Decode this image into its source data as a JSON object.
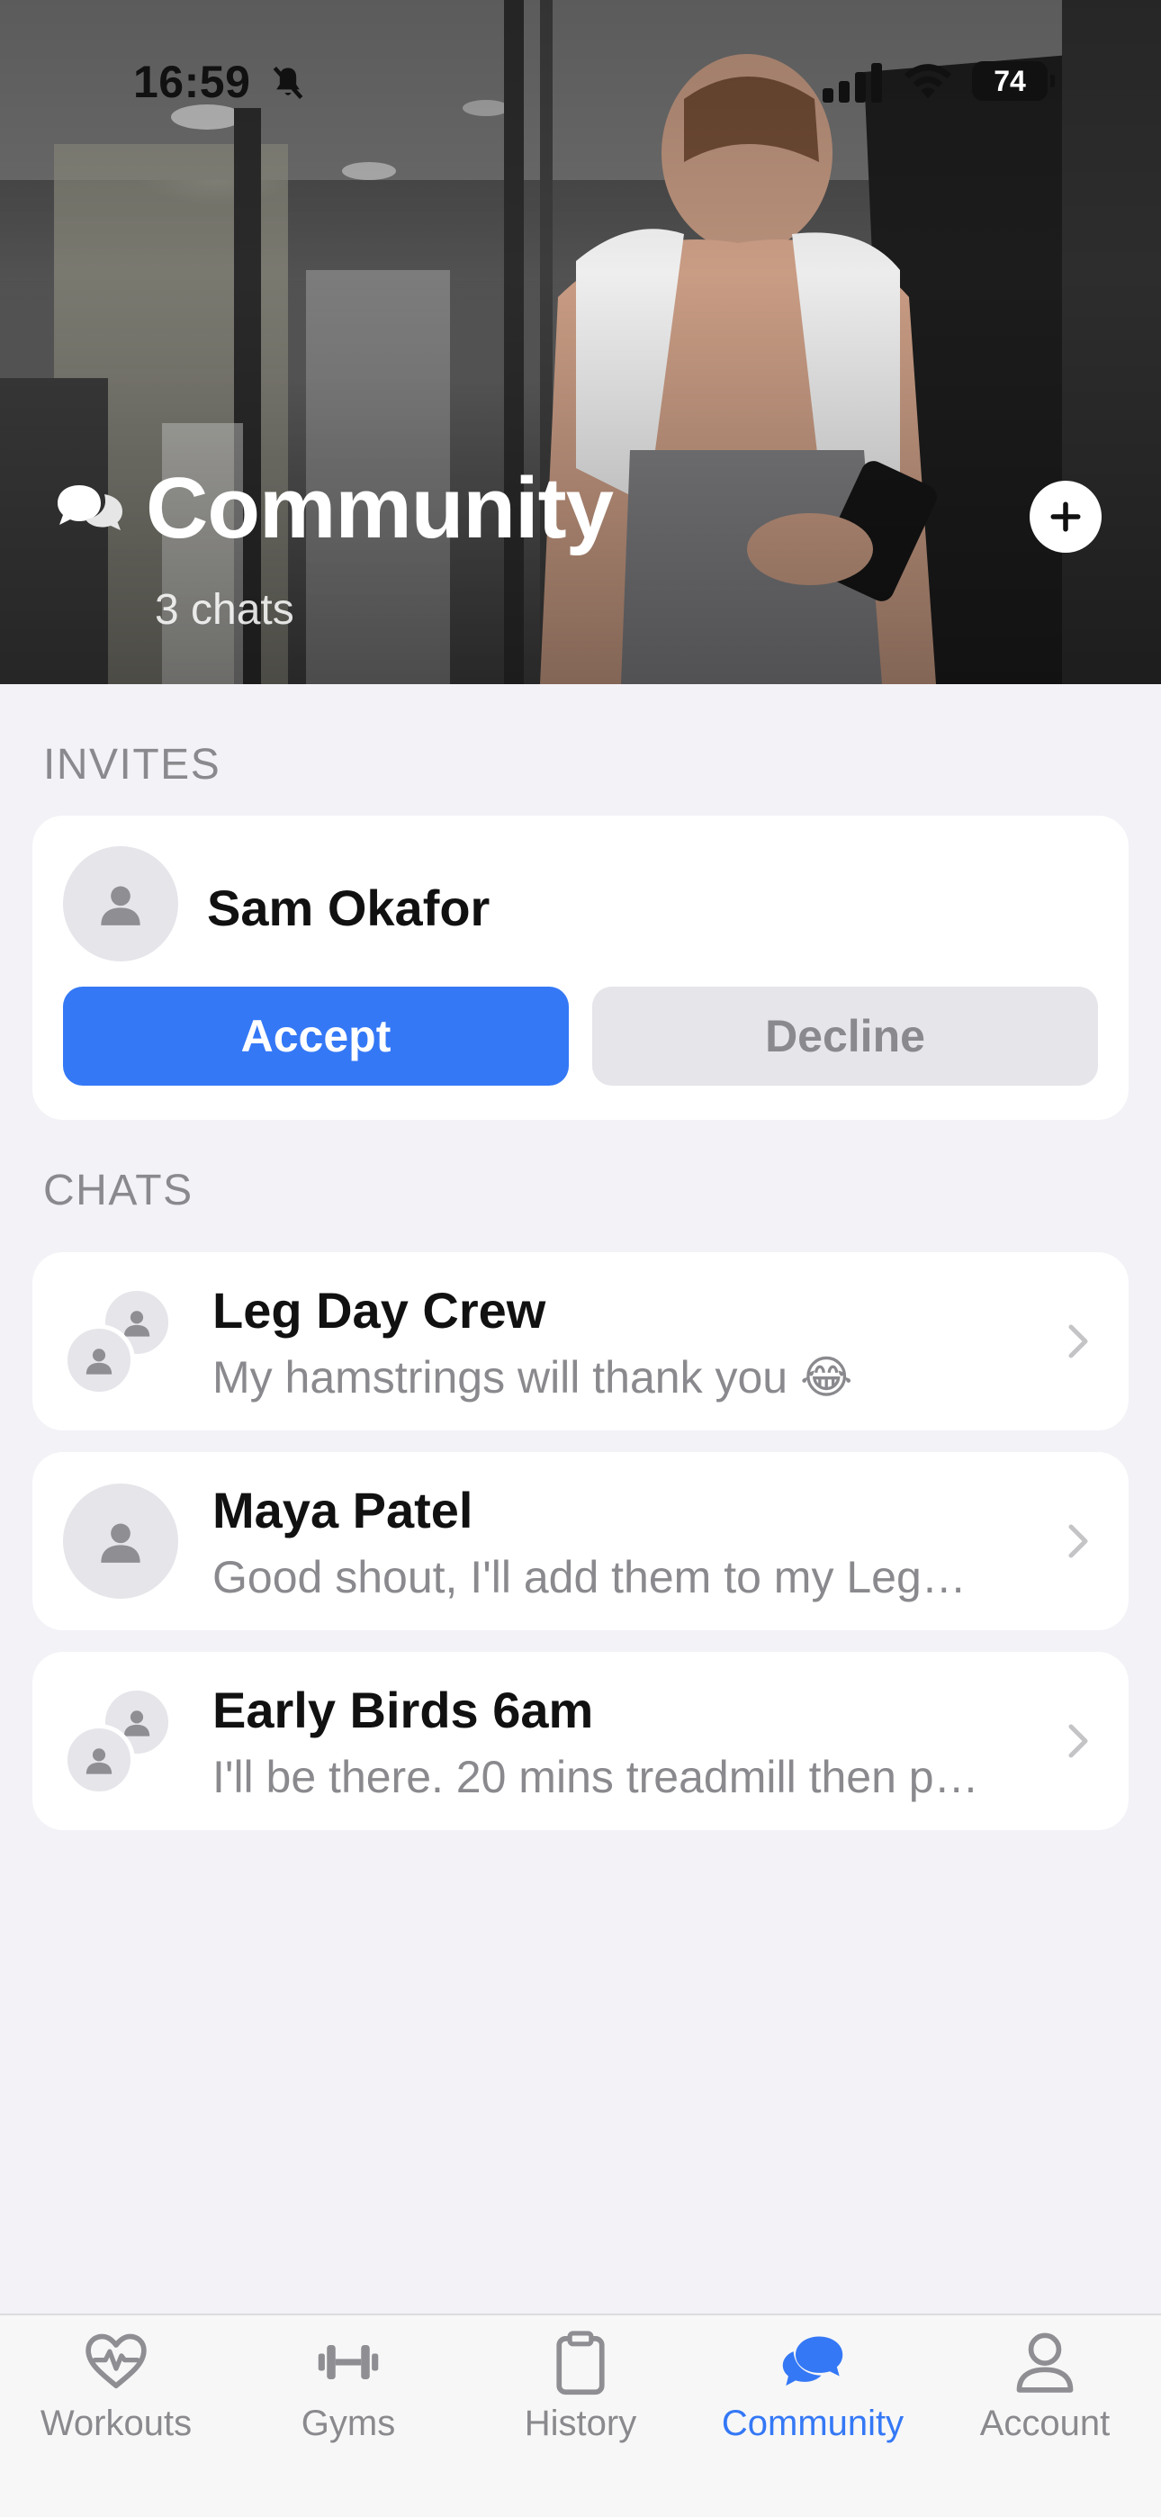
{
  "status_bar": {
    "time": "16:59",
    "battery": "74"
  },
  "hero": {
    "title": "Community",
    "subtitle": "3 chats"
  },
  "invites": {
    "section_label": "INVITES",
    "items": [
      {
        "name": "Sam Okafor",
        "accept_label": "Accept",
        "decline_label": "Decline"
      }
    ]
  },
  "chats": {
    "section_label": "CHATS",
    "items": [
      {
        "title": "Leg Day Crew",
        "preview": "My hamstrings will thank you 😂",
        "group": true
      },
      {
        "title": "Maya Patel",
        "preview": "Good shout, I'll add them to my Leg…",
        "group": false
      },
      {
        "title": "Early Birds 6am",
        "preview": "I'll be there. 20 mins treadmill then p…",
        "group": true
      }
    ]
  },
  "tab_bar": {
    "items": [
      {
        "label": "Workouts",
        "icon": "heart-pulse-icon"
      },
      {
        "label": "Gyms",
        "icon": "dumbbell-icon"
      },
      {
        "label": "History",
        "icon": "clipboard-icon"
      },
      {
        "label": "Community",
        "icon": "chat-bubbles-icon",
        "active": true
      },
      {
        "label": "Account",
        "icon": "person-icon"
      }
    ]
  },
  "colors": {
    "accent": "#3478f6",
    "background": "#f2f2f7",
    "secondary_text": "#8a8a8e"
  }
}
